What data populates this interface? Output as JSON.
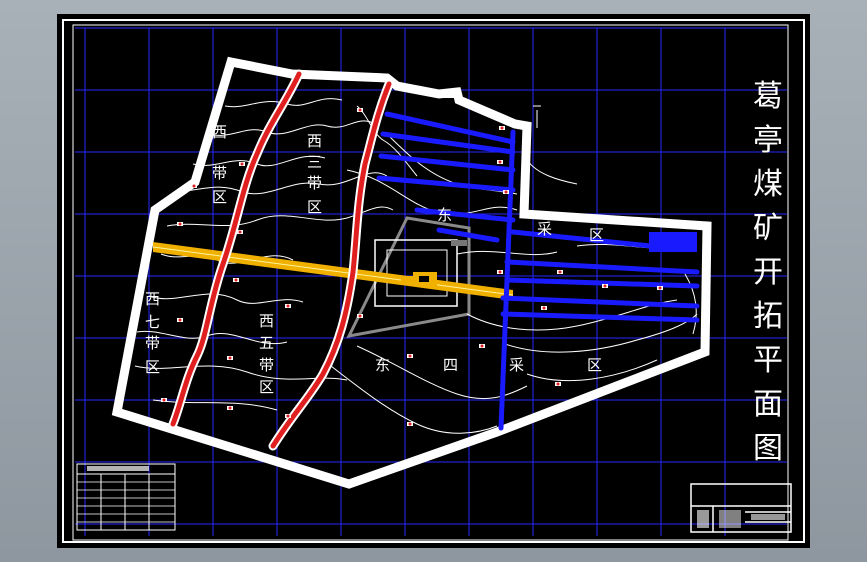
{
  "drawing": {
    "title_chars": [
      "葛",
      "亭",
      "煤",
      "矿",
      "开",
      "拓",
      "平",
      "面",
      "图"
    ],
    "colors": {
      "background": "#000000",
      "grid": "#2828ff",
      "boundary": "#ffffff",
      "roadway_red": "#e02020",
      "roadway_yellow": "#f0b000",
      "roadway_blue": "#1a1aff",
      "contour": "#ffffff",
      "grey_outline": "#808080"
    }
  },
  "zones": {
    "west_belt": [
      "西",
      "带",
      "区"
    ],
    "west_three": [
      "西",
      "三",
      "带",
      "区"
    ],
    "west_seven": [
      "西",
      "七",
      "带",
      "区"
    ],
    "west_five": [
      "西",
      "五",
      "带",
      "区"
    ],
    "east_mining_area": {
      "label_1": "东",
      "label_2": "采",
      "label_3": "区"
    },
    "east_four_mining_area": {
      "label_1": "东",
      "label_2": "四",
      "label_3": "采",
      "label_4": "区"
    }
  }
}
